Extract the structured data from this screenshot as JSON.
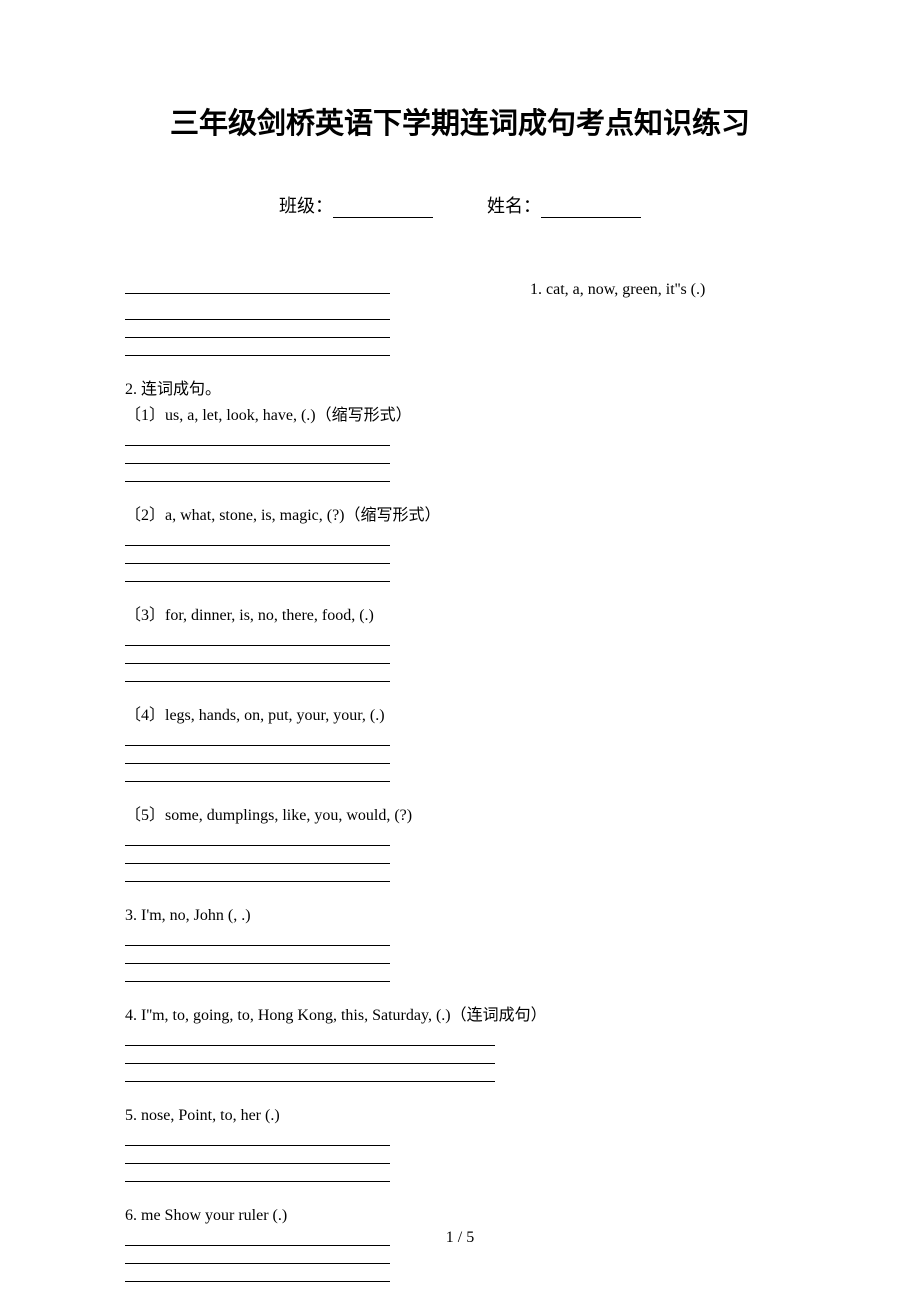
{
  "title": "三年级剑桥英语下学期连词成句考点知识练习",
  "form": {
    "class_label": "班级：",
    "name_label": "姓名："
  },
  "questions": {
    "q1": {
      "text": "1. cat, a, now, green, it''s  (.)"
    },
    "q2": {
      "header": "2. 连词成句。",
      "sub1": "〔1〕us, a, let, look, have, (.)（缩写形式）",
      "sub2": "〔2〕a, what, stone, is, magic, (?)（缩写形式）",
      "sub3": "〔3〕for, dinner, is, no, there, food, (.)",
      "sub4": "〔4〕legs, hands, on, put, your, your, (.)",
      "sub5": "〔5〕some, dumplings, like, you, would, (?)"
    },
    "q3": {
      "text": "3. I'm, no, John (, .)"
    },
    "q4": {
      "text": "4. I''m,   to,   going,   to,   Hong Kong,   this,   Saturday,   (.)（连词成句）"
    },
    "q5": {
      "text": "5. nose, Point, to, her (.)"
    },
    "q6": {
      "text": "6. me  Show  your  ruler (.)"
    }
  },
  "page_number": "1 / 5"
}
